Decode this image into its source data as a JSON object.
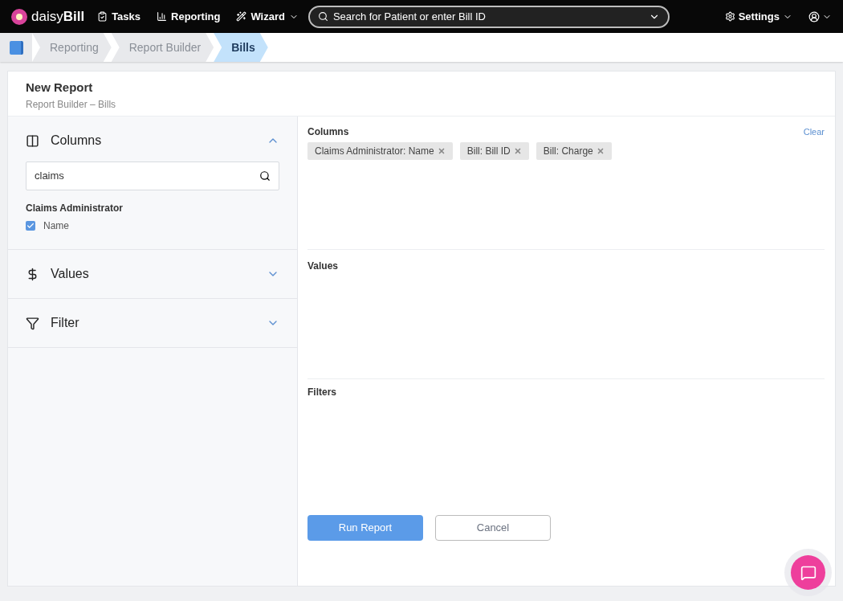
{
  "nav": {
    "brand_light": "daisy",
    "brand_bold": "Bill",
    "items": [
      {
        "kind": "tasks",
        "label": "Tasks",
        "dropdown": false
      },
      {
        "kind": "reporting",
        "label": "Reporting",
        "dropdown": false
      },
      {
        "kind": "wizard",
        "label": "Wizard",
        "dropdown": true
      }
    ],
    "search": {
      "placeholder": "Search for Patient or enter Bill ID"
    },
    "settings": "Settings"
  },
  "breadcrumbs": [
    {
      "label": "Reporting",
      "selected": false
    },
    {
      "label": "Report Builder",
      "selected": false
    },
    {
      "label": "Bills",
      "selected": true
    }
  ],
  "page": {
    "title": "New Report",
    "subtitle": "Report Builder – Bills"
  },
  "sections": [
    {
      "kind": "columns",
      "title": "Columns",
      "expanded": true,
      "search_value": "claims",
      "groups": [
        {
          "title": "Claims Administrator",
          "options": [
            {
              "label": "Name",
              "checked": true
            }
          ]
        }
      ]
    },
    {
      "kind": "values",
      "title": "Values",
      "expanded": false
    },
    {
      "kind": "filter",
      "title": "Filter",
      "expanded": false
    }
  ],
  "builder": {
    "columns": {
      "title": "Columns",
      "clear": "Clear",
      "tags": [
        "Claims Administrator: Name",
        "Bill: Bill ID",
        "Bill: Charge"
      ]
    },
    "values": {
      "title": "Values"
    },
    "filters": {
      "title": "Filters"
    }
  },
  "buttons": {
    "run": "Run Report",
    "cancel": "Cancel"
  }
}
